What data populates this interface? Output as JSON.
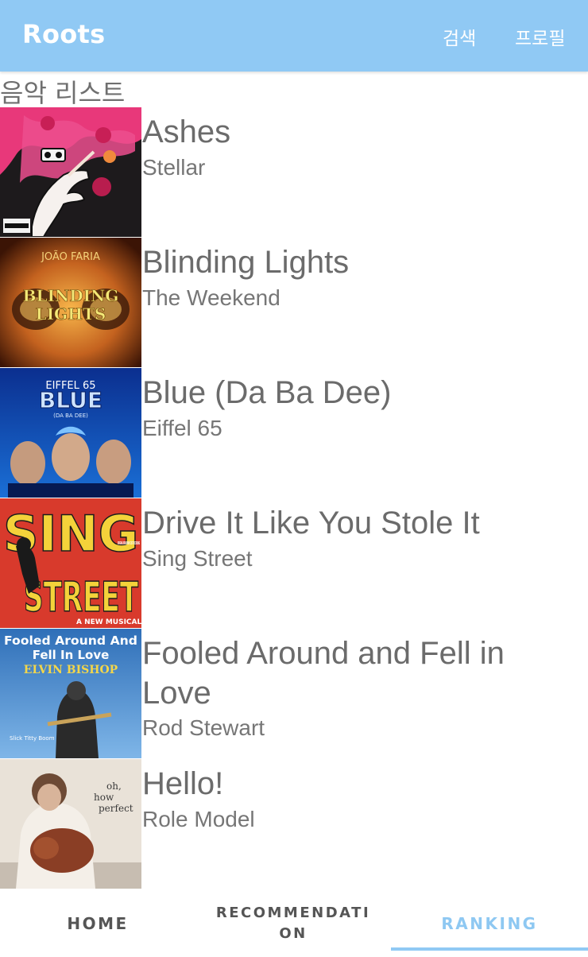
{
  "app_bar": {
    "title": "Roots",
    "search_label": "검색",
    "profile_label": "프로필",
    "color": "#90c9f4"
  },
  "section": {
    "title": "음악 리스트"
  },
  "songs": [
    {
      "title": "Ashes",
      "artist": "Stellar"
    },
    {
      "title": "Blinding Lights",
      "artist": "The Weekend"
    },
    {
      "title": "Blue (Da Ba Dee)",
      "artist": "Eiffel 65"
    },
    {
      "title": "Drive It Like You Stole It",
      "artist": "Sing Street"
    },
    {
      "title": "Fooled Around and Fell in Love",
      "artist": "Rod Stewart"
    },
    {
      "title": "Hello!",
      "artist": "Role Model"
    }
  ],
  "album_art_text": {
    "blinding_artist": "JOÃO FARIA",
    "blinding_title_1": "BLINDING",
    "blinding_title_2": "LIGHTS",
    "eiffel_band": "EIFFEL 65",
    "eiffel_title": "BLUE",
    "eiffel_sub": "(DA BA DEE)",
    "sing_title_1": "SING",
    "sing_title_2": "STREET",
    "sing_note": "ORIGINAL BROADWAY CAST RECORDING",
    "sing_footer": "A NEW MUSICAL",
    "fooled_title_1": "Fooled Around And",
    "fooled_title_2": "Fell In Love",
    "fooled_artist": "ELVIN BISHOP",
    "fooled_side": "Slick Titty Boom",
    "hello_script_1": "oh,",
    "hello_script_2": "how",
    "hello_script_3": "perfect"
  },
  "bottom_tabs": [
    {
      "label": "HOME",
      "active": false
    },
    {
      "label": "RECOMMENDATION",
      "active": false
    },
    {
      "label": "RANKING",
      "active": true
    }
  ]
}
